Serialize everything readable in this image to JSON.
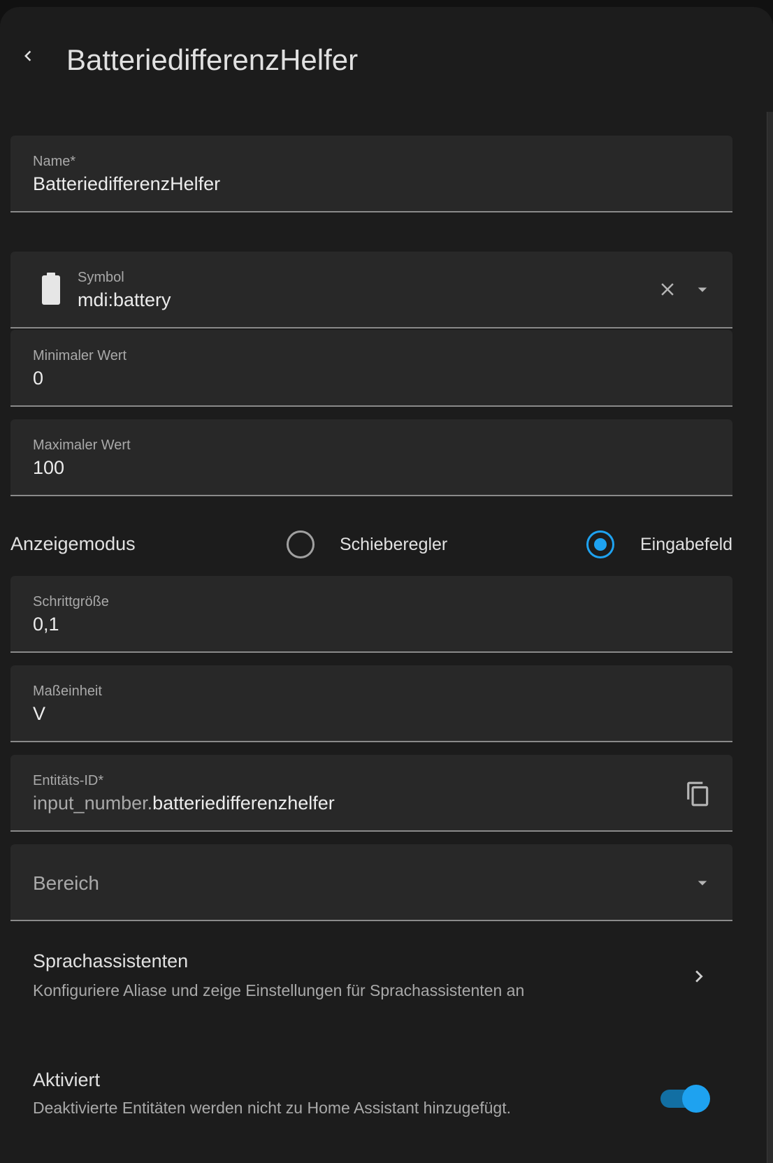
{
  "header": {
    "back_icon": "chevron-left-icon",
    "title": "BatteriedifferenzHelfer"
  },
  "fields": {
    "name": {
      "label": "Name*",
      "value": "BatteriedifferenzHelfer"
    },
    "symbol": {
      "label": "Symbol",
      "value": "mdi:battery",
      "icon": "battery-icon",
      "clear_icon": "close-icon",
      "dropdown_icon": "menu-down-icon"
    },
    "min": {
      "label": "Minimaler Wert",
      "value": "0"
    },
    "max": {
      "label": "Maximaler Wert",
      "value": "100"
    },
    "step": {
      "label": "Schrittgröße",
      "value": "0,1"
    },
    "unit": {
      "label": "Maßeinheit",
      "value": "V"
    },
    "entity_id": {
      "label": "Entitäts-ID*",
      "prefix": "input_number.",
      "value": "batteriedifferenzhelfer",
      "copy_icon": "copy-icon"
    },
    "area": {
      "placeholder": "Bereich",
      "dropdown_icon": "menu-down-icon"
    }
  },
  "display_mode": {
    "label": "Anzeigemodus",
    "options": [
      {
        "label": "Schieberegler",
        "selected": false
      },
      {
        "label": "Eingabefeld",
        "selected": true
      }
    ]
  },
  "voice_assistants": {
    "title": "Sprachassistenten",
    "subtitle": "Konfiguriere Aliase und zeige Einstellungen für Sprachassistenten an",
    "chevron_icon": "chevron-right-icon"
  },
  "enabled": {
    "title": "Aktiviert",
    "subtitle": "Deaktivierte Entitäten werden nicht zu Home Assistant hinzugefügt.",
    "on": true
  },
  "colors": {
    "accent": "#1ea2f0",
    "background": "#1c1c1c",
    "field_background": "#282828"
  }
}
